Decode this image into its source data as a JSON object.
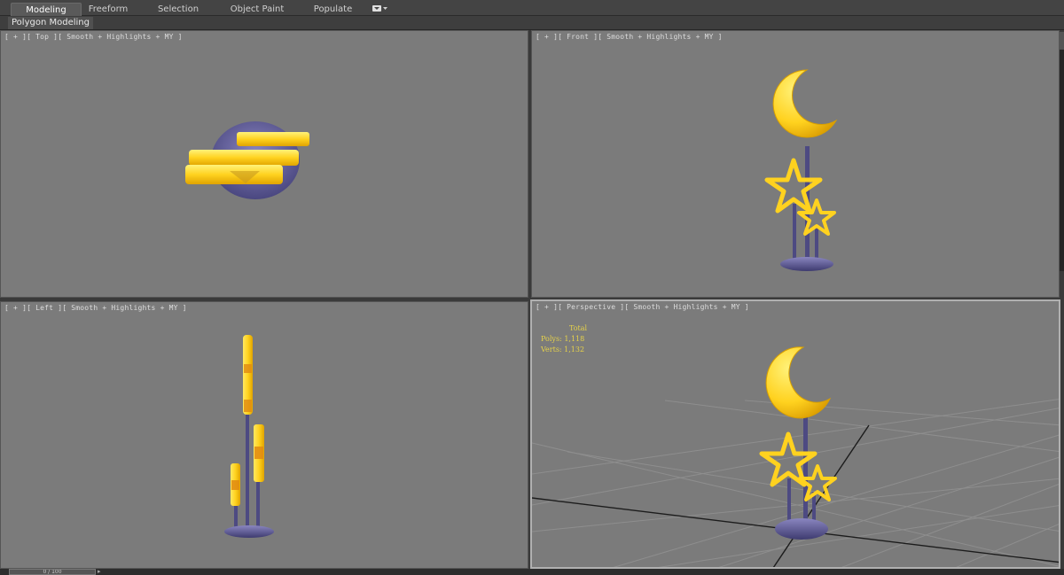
{
  "ribbon": {
    "tabs": [
      {
        "label": "Modeling",
        "active": true
      },
      {
        "label": "Freeform",
        "active": false
      },
      {
        "label": "Selection",
        "active": false
      },
      {
        "label": "Object Paint",
        "active": false
      },
      {
        "label": "Populate",
        "active": false
      }
    ],
    "panel_label": "Polygon Modeling"
  },
  "viewports": {
    "top": {
      "label": "[ + ][ Top ][ Smooth + Highlights + MY ]"
    },
    "front": {
      "label": "[ + ][ Front ][ Smooth + Highlights + MY ]"
    },
    "left": {
      "label": "[ + ][ Left ][ Smooth + Highlights + MY ]"
    },
    "perspective": {
      "label": "[ + ][ Perspective ][ Smooth + Highlights + MY ]",
      "stats": {
        "header": "Total",
        "polys_label": "Polys:",
        "polys_value": "1,118",
        "verts_label": "Verts:",
        "verts_value": "1,132"
      }
    }
  },
  "timeline": {
    "slider_text": "0 / 100"
  },
  "colors": {
    "viewport_bg": "#7b7b7b",
    "model_yellow": "#ffd21f",
    "model_base": "#5b5890",
    "stats_text": "#e6d24a"
  }
}
